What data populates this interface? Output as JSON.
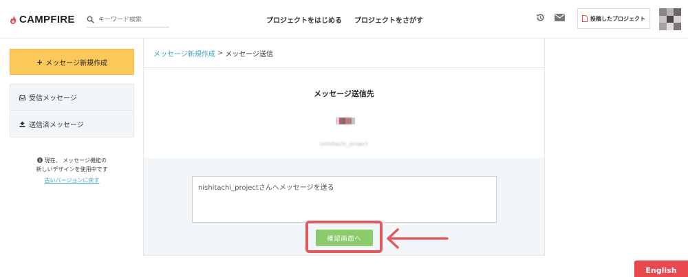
{
  "header": {
    "logo_text": "CAMPFIRE",
    "search_placeholder": "キーワード検索",
    "nav_start": "プロジェクトをはじめる",
    "nav_find": "プロジェクトをさがす",
    "posted_projects": "投稿したプロジェクト"
  },
  "sidebar": {
    "new_message": "メッセージ新規作成",
    "items": [
      {
        "label": "受信メッセージ",
        "icon": "inbox-icon"
      },
      {
        "label": "送信済メッセージ",
        "icon": "upload-icon"
      }
    ],
    "note_line1": "現在、 メッセージ機能の",
    "note_line2": "新しいデザインを使用中です",
    "old_version_link": "古いバージョンに戻す"
  },
  "main": {
    "breadcrumb_link": "メッセージ新規作成",
    "breadcrumb_sep": ">",
    "breadcrumb_current": "メッセージ送信",
    "recipient_title": "メッセージ送信先",
    "recipient_name": "nishitachi_project",
    "message_value": "nishitachi_projectさんへメッセージを送る",
    "confirm_button": "確認画面へ"
  },
  "footer": {
    "language_button": "English"
  },
  "colors": {
    "accent_yellow": "#fcc85a",
    "link_blue": "#39a5c9",
    "confirm_green": "#8ccb6b",
    "highlight_red": "#e25a5e",
    "english_red": "#e9484f"
  }
}
